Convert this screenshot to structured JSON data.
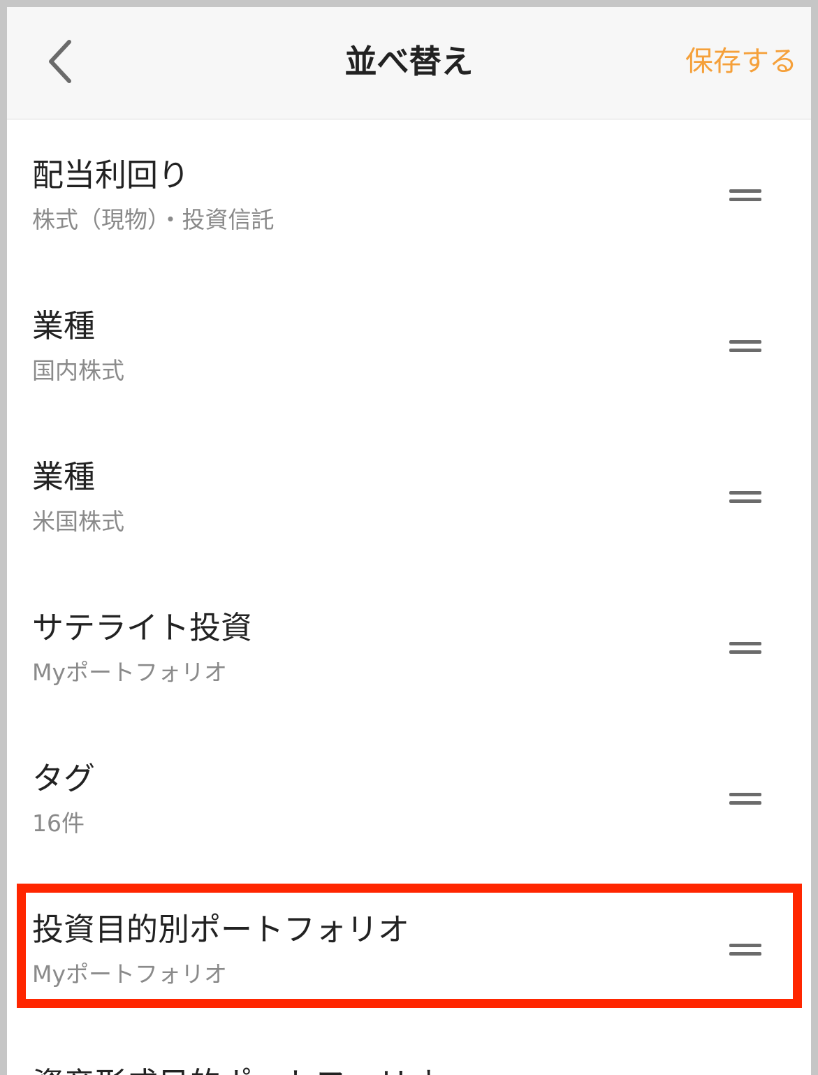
{
  "header": {
    "title": "並べ替え",
    "save_label": "保存する",
    "back_icon": "chevron-left-icon"
  },
  "colors": {
    "accent": "#f5a03a",
    "highlight_border": "#ff2600",
    "title_text": "#222222",
    "sub_text": "#8a8a8a"
  },
  "items": [
    {
      "title": "配当利回り",
      "subtitle": "株式（現物）・投資信託"
    },
    {
      "title": "業種",
      "subtitle": "国内株式"
    },
    {
      "title": "業種",
      "subtitle": "米国株式"
    },
    {
      "title": "サテライト投資",
      "subtitle": "Myポートフォリオ"
    },
    {
      "title": "タグ",
      "subtitle": "16件"
    },
    {
      "title": "投資目的別ポートフォリオ",
      "subtitle": "Myポートフォリオ"
    }
  ],
  "partial_item": {
    "title": "資産形成目的ポートフォリオ"
  }
}
